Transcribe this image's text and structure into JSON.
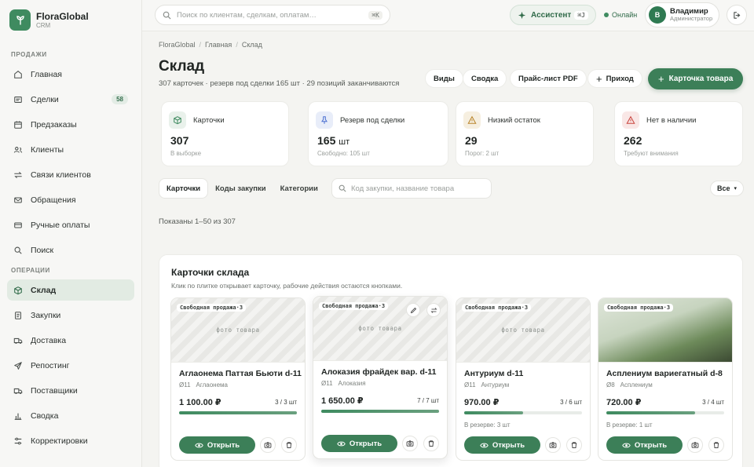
{
  "brand": {
    "name": "FloraGlobal",
    "sub": "CRM"
  },
  "sidebar": {
    "sections": [
      {
        "title": "ПРОДАЖИ",
        "items": [
          {
            "label": "Главная",
            "icon": "home-icon"
          },
          {
            "label": "Сделки",
            "icon": "deals-icon",
            "badge": "58"
          },
          {
            "label": "Предзаказы",
            "icon": "calendar-icon"
          },
          {
            "label": "Клиенты",
            "icon": "users-icon"
          },
          {
            "label": "Связи клиентов",
            "icon": "swap-icon"
          },
          {
            "label": "Обращения",
            "icon": "mail-icon"
          },
          {
            "label": "Ручные оплаты",
            "icon": "card-icon"
          },
          {
            "label": "Поиск",
            "icon": "search-icon"
          }
        ]
      },
      {
        "title": "ОПЕРАЦИИ",
        "items": [
          {
            "label": "Склад",
            "icon": "box-icon",
            "active": true
          },
          {
            "label": "Закупки",
            "icon": "doc-icon"
          },
          {
            "label": "Доставка",
            "icon": "truck-icon"
          },
          {
            "label": "Репостинг",
            "icon": "send-icon"
          },
          {
            "label": "Поставщики",
            "icon": "truck-icon"
          },
          {
            "label": "Сводка",
            "icon": "chart-icon"
          },
          {
            "label": "Корректировки",
            "icon": "sliders-icon"
          }
        ]
      }
    ]
  },
  "topbar": {
    "search_placeholder": "Поиск по клиентам, сделкам, оплатам…",
    "search_kbd": "⌘K",
    "assistant": "Ассистент",
    "assistant_kbd": "⌘J",
    "status": "Онлайн",
    "user_initial": "В",
    "user_name": "Владимир",
    "user_role": "Администратор"
  },
  "breadcrumb": [
    "FloraGlobal",
    "Главная",
    "Склад"
  ],
  "page": {
    "title": "Склад",
    "subtitle": "307 карточек · резерв под сделки 165 шт · 29 позиций заканчиваются",
    "actions": [
      "Виды",
      "Сводка",
      "Прайс-лист PDF",
      "Приход"
    ],
    "primary_action": "Карточка товара"
  },
  "stats": [
    {
      "label": "Карточки",
      "value": "307",
      "unit": "",
      "hint": "В выборке",
      "color": "#3f8b60"
    },
    {
      "label": "Резерв под сделки",
      "value": "165",
      "unit": "шт",
      "hint": "Свободно: 105 шт",
      "color": "#4a6fd1"
    },
    {
      "label": "Низкий остаток",
      "value": "29",
      "unit": "",
      "hint": "Порог: 2 шт",
      "color": "#b8842a"
    },
    {
      "label": "Нет в наличии",
      "value": "262",
      "unit": "",
      "hint": "Требуют внимания",
      "color": "#c9453f"
    }
  ],
  "tabs": [
    "Карточки",
    "Коды закупки",
    "Категории"
  ],
  "filter_placeholder": "Код закупки, название товара",
  "select_value": "Все",
  "shown_text": "Показаны 1–50 из 307",
  "panel": {
    "title": "Карточки склада",
    "subtitle": "Клик по плитке открывает карточку, рабочие действия остаются кнопками."
  },
  "cards": [
    {
      "tag": "Свободная продажа·3",
      "photo_label": "фото товара",
      "name": "Аглаонема Паттая Бьюти d-11",
      "diameter": "Ø11",
      "genus": "Аглаонема",
      "price": "1 100.00 ₽",
      "qty": "3 / 3 шт",
      "fill": 1.0,
      "reserve": ""
    },
    {
      "tag": "Свободная продажа·3",
      "photo_label": "фото товара",
      "name": "Алоказия фрайдек вар. d-11",
      "diameter": "Ø11",
      "genus": "Алоказия",
      "price": "1 650.00 ₽",
      "qty": "7 / 7 шт",
      "fill": 1.0,
      "reserve": ""
    },
    {
      "tag": "Свободная продажа·3",
      "photo_label": "фото товара",
      "name": "Антуриум d-11",
      "diameter": "Ø11",
      "genus": "Антуриум",
      "price": "970.00 ₽",
      "qty": "3 / 6 шт",
      "fill": 0.5,
      "reserve": "В резерве: 3 шт"
    },
    {
      "tag": "Свободная продажа·3",
      "photo_label": "",
      "name": "Асплениум вариегатный d-8",
      "diameter": "Ø8",
      "genus": "Асплениум",
      "price": "720.00 ₽",
      "qty": "3 / 4 шт",
      "fill": 0.75,
      "reserve": "В резерве: 1 шт"
    }
  ],
  "open_label": "Открыть"
}
